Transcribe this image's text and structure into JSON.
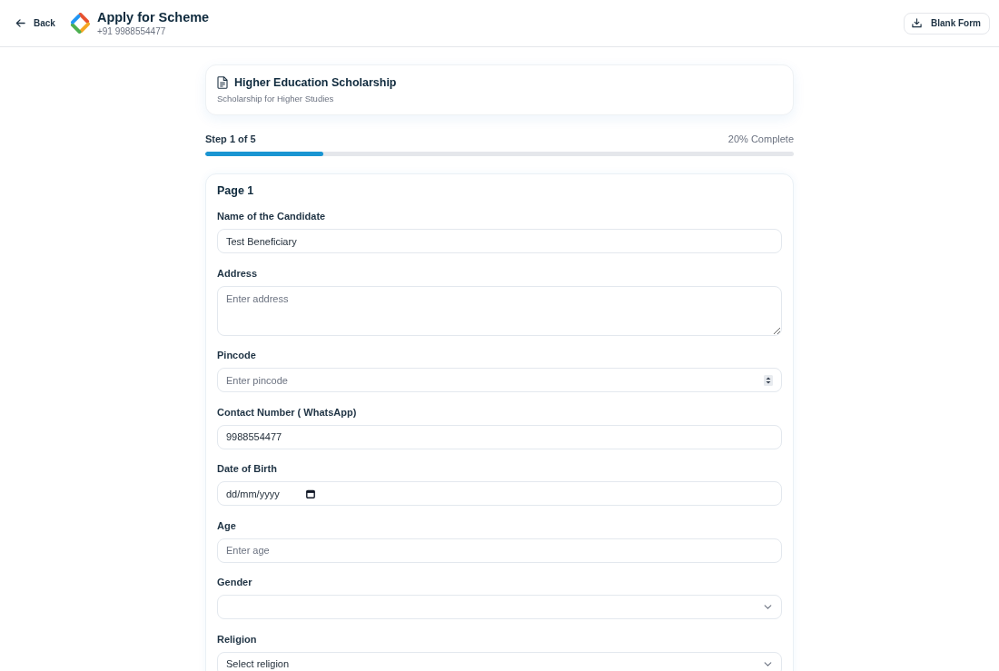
{
  "header": {
    "back_button": "Back",
    "title": "Apply for Scheme",
    "subtitle": "+91 9988554477",
    "blank_form_button": "Blank Form"
  },
  "scheme": {
    "title": "Higher Education Scholarship",
    "description": "Scholarship for Higher Studies"
  },
  "progress": {
    "step": "Step 1 of 5",
    "percent_label": "20% Complete",
    "level": 0.2
  },
  "form": {
    "page_title": "Page 1",
    "fields": [
      {
        "kind": "text",
        "label": "Name of the Candidate",
        "value": "Test Beneficiary"
      },
      {
        "kind": "textarea",
        "label": "Address",
        "placeholder": "Enter address"
      },
      {
        "kind": "number",
        "label": "Pincode",
        "placeholder": "Enter pincode"
      },
      {
        "kind": "text",
        "label": "Contact Number ( WhatsApp)",
        "value": "9988554477"
      },
      {
        "kind": "date",
        "label": "Date of Birth",
        "placeholder": "dd/mm/yyyy"
      },
      {
        "kind": "text",
        "label": "Age",
        "placeholder": "Enter age"
      },
      {
        "kind": "select",
        "label": "Gender"
      },
      {
        "kind": "select",
        "label": "Religion",
        "value": "Select religion"
      }
    ]
  }
}
